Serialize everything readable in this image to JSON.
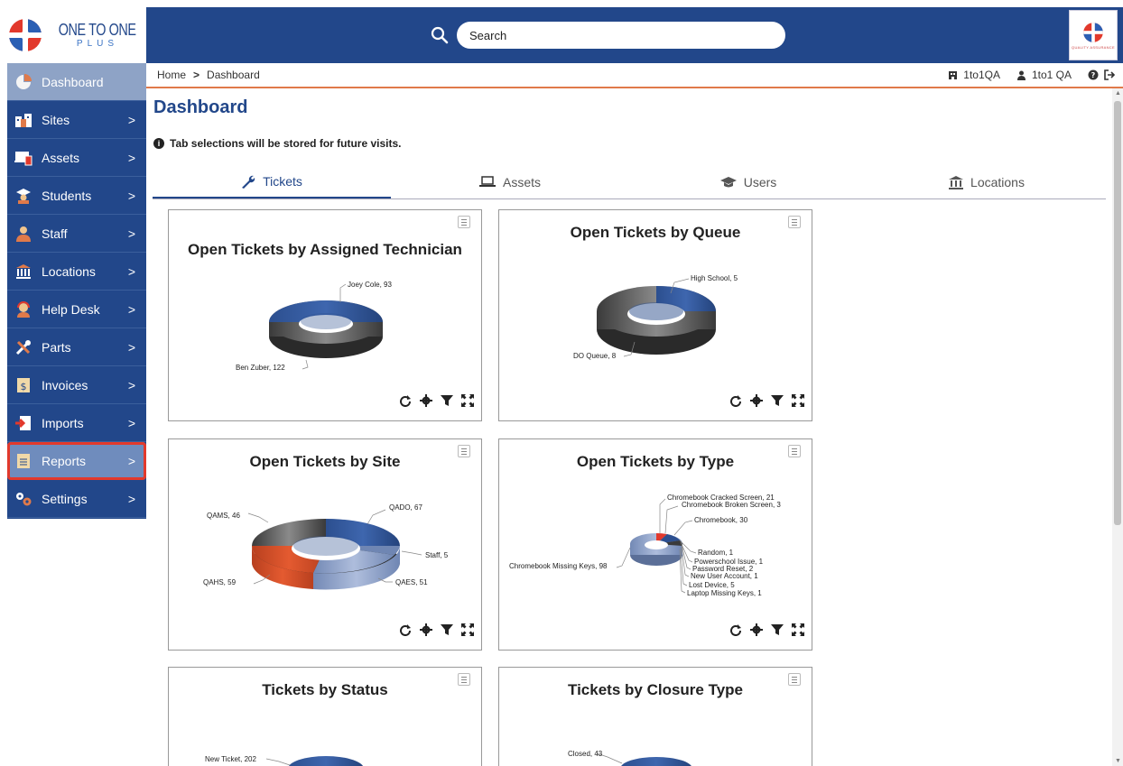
{
  "brand": {
    "line1": "ONE TO ONE",
    "line2": "PLUS",
    "corner_sub": "QUALITY ASSURANCE"
  },
  "search": {
    "placeholder": "Search"
  },
  "breadcrumb": {
    "home": "Home",
    "current": "Dashboard"
  },
  "user": {
    "site": "1to1QA",
    "name": "1to1 QA"
  },
  "sidebar": {
    "items": [
      {
        "label": "Dashboard",
        "icon": "pie-chart-icon"
      },
      {
        "label": "Sites",
        "icon": "sites-icon"
      },
      {
        "label": "Assets",
        "icon": "devices-icon"
      },
      {
        "label": "Students",
        "icon": "student-icon"
      },
      {
        "label": "Staff",
        "icon": "staff-icon"
      },
      {
        "label": "Locations",
        "icon": "building-icon"
      },
      {
        "label": "Help Desk",
        "icon": "headset-icon"
      },
      {
        "label": "Parts",
        "icon": "tools-icon"
      },
      {
        "label": "Invoices",
        "icon": "invoice-icon"
      },
      {
        "label": "Imports",
        "icon": "import-icon"
      },
      {
        "label": "Reports",
        "icon": "report-icon"
      },
      {
        "label": "Settings",
        "icon": "gears-icon"
      }
    ]
  },
  "page": {
    "title": "Dashboard",
    "notice": "Tab selections will be stored for future visits."
  },
  "tabs": [
    {
      "label": "Tickets",
      "icon": "wrench-icon"
    },
    {
      "label": "Assets",
      "icon": "laptop-icon"
    },
    {
      "label": "Users",
      "icon": "graduation-cap-icon"
    },
    {
      "label": "Locations",
      "icon": "bank-icon"
    }
  ],
  "widgets": {
    "technician": {
      "title": "Open Tickets by Assigned Technician",
      "labels": [
        "Joey Cole, 93",
        "Ben Zuber, 122"
      ]
    },
    "queue": {
      "title": "Open Tickets by Queue",
      "labels": [
        "High School, 5",
        "DO Queue, 8"
      ]
    },
    "site": {
      "title": "Open Tickets by Site",
      "labels": [
        "QAMS, 46",
        "QADO, 67",
        "Staff, 5",
        "QAHS, 59",
        "QAES, 51"
      ]
    },
    "type": {
      "title": "Open Tickets by Type",
      "labels": [
        "Chromebook Cracked Screen, 21",
        "Chromebook Broken Screen, 3",
        "Chromebook, 30",
        "Chromebook Missing Keys, 98",
        "Random, 1",
        "Powerschool Issue, 1",
        "Password Reset, 2",
        "New User Account, 1",
        "Lost Device, 5",
        "Laptop Missing Keys, 1"
      ]
    },
    "status": {
      "title": "Tickets by Status",
      "labels": [
        "New Ticket, 202"
      ]
    },
    "closure": {
      "title": "Tickets by Closure Type",
      "labels": [
        "Closed, 43"
      ]
    }
  },
  "chart_data": [
    {
      "type": "pie",
      "title": "Open Tickets by Assigned Technician",
      "categories": [
        "Joey Cole",
        "Ben Zuber"
      ],
      "values": [
        93,
        122
      ]
    },
    {
      "type": "pie",
      "title": "Open Tickets by Queue",
      "categories": [
        "High School",
        "DO Queue"
      ],
      "values": [
        5,
        8
      ]
    },
    {
      "type": "pie",
      "title": "Open Tickets by Site",
      "categories": [
        "QADO",
        "Staff",
        "QAES",
        "QAHS",
        "QAMS"
      ],
      "values": [
        67,
        5,
        51,
        59,
        46
      ]
    },
    {
      "type": "pie",
      "title": "Open Tickets by Type",
      "categories": [
        "Chromebook Cracked Screen",
        "Chromebook Broken Screen",
        "Chromebook",
        "Random",
        "Powerschool Issue",
        "Password Reset",
        "New User Account",
        "Lost Device",
        "Laptop Missing Keys",
        "Chromebook Missing Keys"
      ],
      "values": [
        21,
        3,
        30,
        1,
        1,
        2,
        1,
        5,
        1,
        98
      ]
    },
    {
      "type": "pie",
      "title": "Tickets by Status",
      "categories": [
        "New Ticket"
      ],
      "values": [
        202
      ]
    },
    {
      "type": "pie",
      "title": "Tickets by Closure Type",
      "categories": [
        "Closed"
      ],
      "values": [
        43
      ]
    }
  ],
  "colors": {
    "brand_blue": "#22478a",
    "accent_orange": "#e07a4a",
    "highlight_red": "#e2392c"
  }
}
